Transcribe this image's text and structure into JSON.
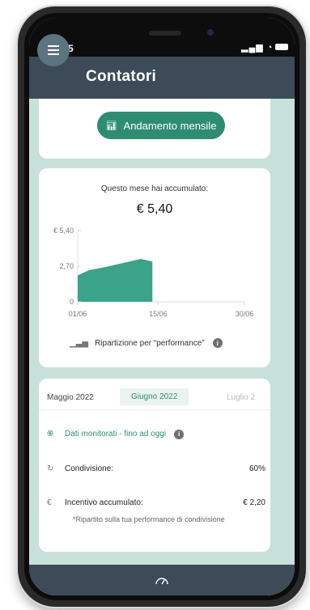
{
  "status": {
    "time": "13:15",
    "signal": "▂▄▆",
    "wifi": "◔"
  },
  "header": {
    "title": "Contatori",
    "menu_icon": "hamburger-menu-icon"
  },
  "monthly_button": {
    "label": "Andamento mensile",
    "icon": "bar-chart-icon"
  },
  "summary": {
    "label": "Questo mese hai accumulato:",
    "value": "€ 5,40"
  },
  "chart_data": {
    "type": "area",
    "x": [
      "01/06",
      "03/06",
      "06/06",
      "09/06",
      "12/06",
      "14/06"
    ],
    "y": [
      2.0,
      2.4,
      2.65,
      2.95,
      3.25,
      3.05
    ],
    "y_ticks": [
      "€ 5,40",
      "2,70",
      "0"
    ],
    "x_ticks": [
      "01/06",
      "15/06",
      "30/06"
    ],
    "ylim": [
      0,
      5.4
    ],
    "xlim": [
      1,
      30
    ],
    "fill_color": "#3aa389"
  },
  "breakdown": {
    "label": "Ripartizione per “performance”",
    "icon": "bar-chart-icon"
  },
  "months": {
    "prev": "Maggio 2022",
    "current": "Giugno 2022",
    "next": "Luglio 2"
  },
  "details": {
    "monitored": "Dati monitorati - fino ad oggi",
    "sharing_label": "Condivisione:",
    "sharing_value": "60%",
    "incentive_label": "Incentivo accumulato:",
    "incentive_value": "€ 2,20",
    "note": "*Ripartito sulla tua performance di condivisione"
  },
  "colors": {
    "accent": "#2e8c73",
    "header": "#3c4b57",
    "background": "#c8e0da"
  }
}
